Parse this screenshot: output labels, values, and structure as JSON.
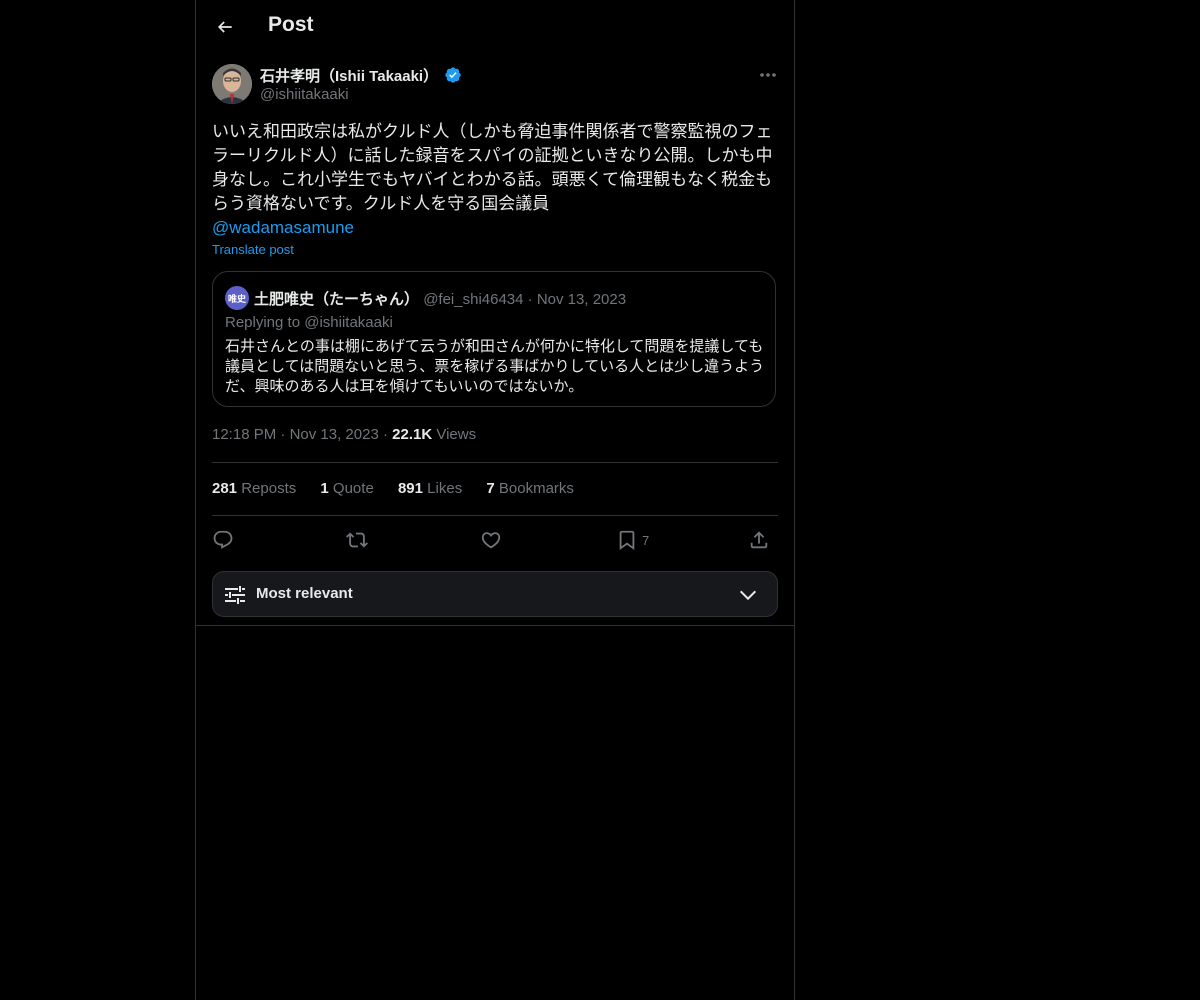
{
  "header": {
    "title": "Post"
  },
  "post": {
    "author_name": "石井孝明（Ishii Takaaki）",
    "author_handle": "@ishiitakaaki",
    "text": "いいえ和田政宗は私がクルド人（しかも脅迫事件関係者で警察監視のフェラーリクルド人）に話した録音をスパイの証拠といきなり公開。しかも中身なし。これ小学生でもヤバイとわかる話。頭悪くて倫理観もなく税金もらう資格ないです。クルド人を守る国会議員",
    "mention": "@wadamasamune",
    "translate_label": "Translate post",
    "time": "12:18 PM",
    "date": "Nov 13, 2023",
    "views_count": "22.1K",
    "views_label": "Views"
  },
  "quote": {
    "avatar_text": "唯史",
    "author_name": "土肥唯史（たーちゃん）",
    "author_handle": "@fei_shi46434",
    "separator": "·",
    "date": "Nov 13, 2023",
    "replying_to": "Replying to @ishiitakaaki",
    "text": "石井さんとの事は棚にあげて云うが和田さんが何かに特化して問題を提議しても議員としては問題ないと思う、票を稼げる事ばかりしている人とは少し違うようだ、興味のある人は耳を傾けてもいいのではないか。"
  },
  "stats": {
    "reposts_count": "281",
    "reposts_label": "Reposts",
    "quotes_count": "1",
    "quotes_label": "Quote",
    "likes_count": "891",
    "likes_label": "Likes",
    "bookmarks_count": "7",
    "bookmarks_label": "Bookmarks"
  },
  "actions": {
    "bookmark_count": "7"
  },
  "sort": {
    "label": "Most relevant"
  },
  "icons": {
    "back": "arrow-left-icon",
    "verified": "verified-badge-icon",
    "more": "more-horizontal-icon",
    "reply": "reply-icon",
    "repost": "repost-icon",
    "like": "heart-icon",
    "bookmark": "bookmark-icon",
    "share": "share-icon",
    "sort": "sliders-icon",
    "chevron": "chevron-down-icon"
  },
  "colors": {
    "accent": "#1d9bf0",
    "background": "#000000",
    "text_primary": "#e7e9ea",
    "text_secondary": "#71767b",
    "border": "#2f3336"
  }
}
